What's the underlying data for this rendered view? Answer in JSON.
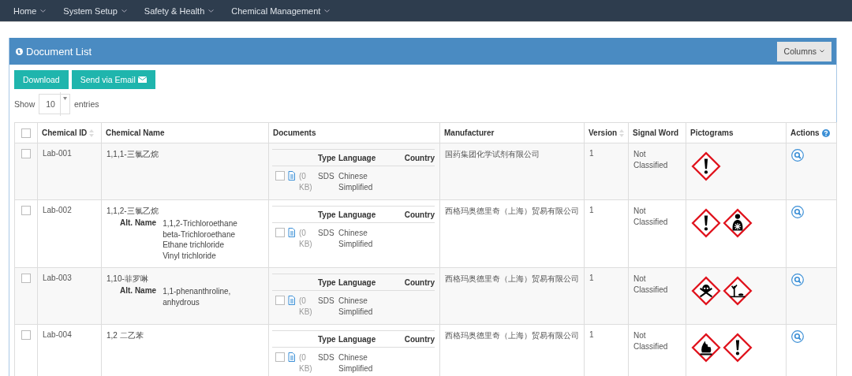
{
  "nav": [
    {
      "label": "Home"
    },
    {
      "label": "System Setup"
    },
    {
      "label": "Safety & Health"
    },
    {
      "label": "Chemical Management"
    }
  ],
  "panel": {
    "title": "Document List",
    "columns_button": "Columns"
  },
  "buttons": [
    {
      "label": "Download",
      "kind": "plain"
    },
    {
      "label": "Send via Email",
      "kind": "email"
    }
  ],
  "length": {
    "before": "Show",
    "value": "10",
    "after": "entries"
  },
  "table": {
    "select_all": {
      "checked": false
    },
    "columns": [
      {
        "label": "Chemical ID",
        "sortable": true
      },
      {
        "label": "Chemical Name",
        "sortable": false
      },
      {
        "label": "Documents",
        "sortable": false
      },
      {
        "label": "Manufacturer",
        "sortable": false
      },
      {
        "label": "Version",
        "sortable": true
      },
      {
        "label": "Signal Word",
        "sortable": false
      },
      {
        "label": "Pictograms",
        "sortable": false
      },
      {
        "label": "Actions",
        "sortable": false,
        "help": true
      }
    ],
    "rows": [
      {
        "checked": false,
        "id": "Lab-001",
        "name": "1,1,1-三氯乙烷",
        "documents": {
          "columns": [
            "Type",
            "Language",
            "Country"
          ],
          "files": [
            {
              "checked": false,
              "size": "(0 KB)",
              "type": "SDS",
              "language": "Chinese Simplified"
            }
          ]
        },
        "manufacturer": "国药集团化学试剂有限公司",
        "version": "1",
        "signal_word": "Not Classified",
        "pictograms": [
          {
            "kind": "exclamation"
          }
        ]
      },
      {
        "checked": false,
        "id": "Lab-002",
        "name": "1,1,2-三氯乙烷",
        "alt_label": "Alt. Name",
        "alt_names": [
          "1,1,2-Trichloroethane",
          "beta-Trichloroethane",
          "Ethane trichloride",
          "Vinyl trichloride"
        ],
        "documents": {
          "columns": [
            "Type",
            "Language",
            "Country"
          ],
          "files": [
            {
              "checked": false,
              "size": "(0 KB)",
              "type": "SDS",
              "language": "Chinese Simplified"
            }
          ]
        },
        "manufacturer": "西格玛奥德里奇（上海）贸易有限公司",
        "version": "1",
        "signal_word": "Not Classified",
        "pictograms": [
          {
            "kind": "exclamation"
          },
          {
            "kind": "health"
          }
        ]
      },
      {
        "checked": false,
        "id": "Lab-003",
        "name": "1,10-菲罗啉",
        "alt_label": "Alt. Name",
        "alt_names": [
          "1,1-phenanthroline, anhydrous"
        ],
        "documents": {
          "columns": [
            "Type",
            "Language",
            "Country"
          ],
          "files": [
            {
              "checked": false,
              "size": "(0 KB)",
              "type": "SDS",
              "language": "Chinese Simplified"
            }
          ]
        },
        "manufacturer": "西格玛奥德里奇（上海）贸易有限公司",
        "version": "1",
        "signal_word": "Not Classified",
        "pictograms": [
          {
            "kind": "skull"
          },
          {
            "kind": "environment"
          }
        ]
      },
      {
        "checked": false,
        "id": "Lab-004",
        "name": "1,2 二乙苯",
        "documents": {
          "columns": [
            "Type",
            "Language",
            "Country"
          ],
          "files": [
            {
              "checked": false,
              "size": "(0 KB)",
              "type": "SDS",
              "language": "Chinese Simplified"
            }
          ]
        },
        "manufacturer": "西格玛奥德里奇（上海）贸易有限公司",
        "version": "1",
        "signal_word": "Not Classified",
        "pictograms": [
          {
            "kind": "flame"
          },
          {
            "kind": "exclamation"
          }
        ]
      }
    ]
  }
}
